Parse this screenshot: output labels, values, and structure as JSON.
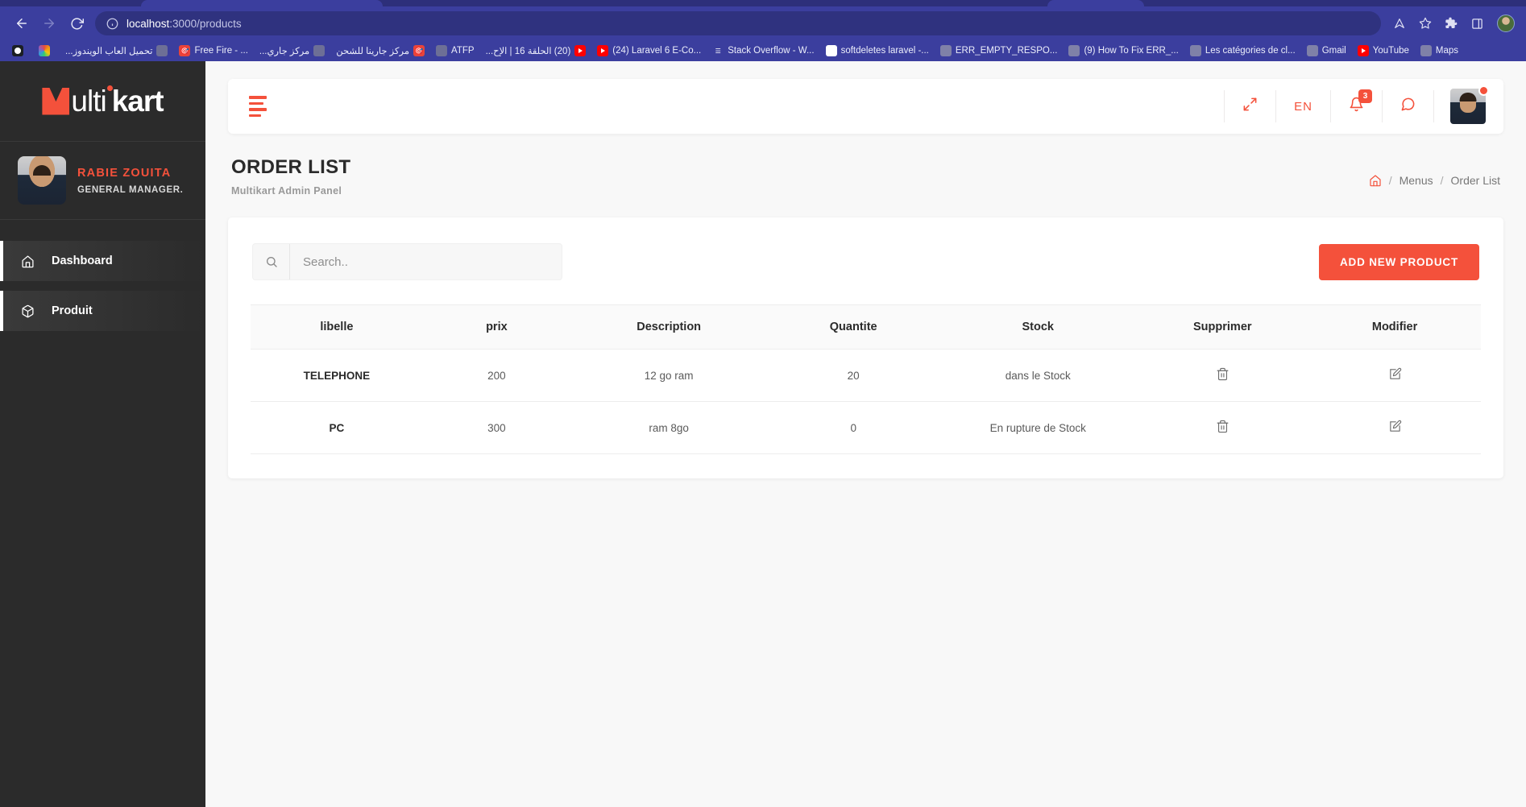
{
  "browser": {
    "url_host": "localhost",
    "url_path": ":3000/products",
    "nav": {
      "back": "back-arrow",
      "forward": "forward-arrow",
      "reload": "reload"
    },
    "bookmarks": [
      {
        "label": "",
        "favicon": "github-icon",
        "rtl": false
      },
      {
        "label": "",
        "favicon": "rainbow-icon",
        "rtl": false
      },
      {
        "label": "تحميل العاب الويندوز...",
        "favicon": "globe-icon",
        "rtl": true
      },
      {
        "label": "Free Fire - ...",
        "favicon": "red-icon",
        "rtl": false
      },
      {
        "label": "مركز جاري...",
        "favicon": "globe-icon",
        "rtl": true
      },
      {
        "label": "مركز جارينا للشحن",
        "favicon": "red-icon",
        "rtl": true
      },
      {
        "label": "ATFP",
        "favicon": "globe-icon",
        "rtl": false
      },
      {
        "label": "(20) الحلقة 16 | الإح...",
        "favicon": "youtube-icon",
        "rtl": true
      },
      {
        "label": "(24) Laravel 6 E-Co...",
        "favicon": "youtube-icon",
        "rtl": false
      },
      {
        "label": "Stack Overflow - W...",
        "favicon": "stackoverflow-icon",
        "rtl": false
      },
      {
        "label": "softdeletes laravel -...",
        "favicon": "google-icon",
        "rtl": false
      },
      {
        "label": "ERR_EMPTY_RESPO...",
        "favicon": "globe-gray-icon",
        "rtl": false
      },
      {
        "label": "(9) How To Fix ERR_...",
        "favicon": "globe-gray-icon",
        "rtl": false
      },
      {
        "label": "Les catégories de cl...",
        "favicon": "globe-gray-icon",
        "rtl": false
      },
      {
        "label": "Gmail",
        "favicon": "globe-gray-icon",
        "rtl": false
      },
      {
        "label": "YouTube",
        "favicon": "youtube-icon",
        "rtl": false
      },
      {
        "label": "Maps",
        "favicon": "globe-gray-icon",
        "rtl": false
      }
    ]
  },
  "sidebar": {
    "logo": {
      "mark": "M",
      "light": "ulti",
      "bold": "kart"
    },
    "user": {
      "name": "RABIE ZOUITA",
      "role": "GENERAL MANAGER."
    },
    "items": [
      {
        "label": "Dashboard",
        "icon": "home-icon"
      },
      {
        "label": "Produit",
        "icon": "box-icon"
      }
    ]
  },
  "topbar": {
    "language": "EN",
    "notification_count": "3"
  },
  "page": {
    "title": "ORDER LIST",
    "subtitle": "Multikart Admin Panel",
    "breadcrumb": [
      "Menus",
      "Order List"
    ],
    "breadcrumb_separator": "/"
  },
  "toolbar": {
    "search_placeholder": "Search..",
    "search_value": "",
    "add_button": "ADD NEW PRODUCT"
  },
  "table": {
    "columns": [
      "libelle",
      "prix",
      "Description",
      "Quantite",
      "Stock",
      "Supprimer",
      "Modifier"
    ],
    "rows": [
      {
        "libelle": "TELEPHONE",
        "prix": "200",
        "description": "12 go ram",
        "quantite": "20",
        "stock": "dans le Stock"
      },
      {
        "libelle": "PC",
        "prix": "300",
        "description": "ram 8go",
        "quantite": "0",
        "stock": "En rupture de Stock"
      }
    ]
  },
  "colors": {
    "accent": "#f4513b",
    "sidebar_bg": "#2b2b2b",
    "browser_bg": "#3b3e9e",
    "page_bg": "#f8f8f8"
  }
}
